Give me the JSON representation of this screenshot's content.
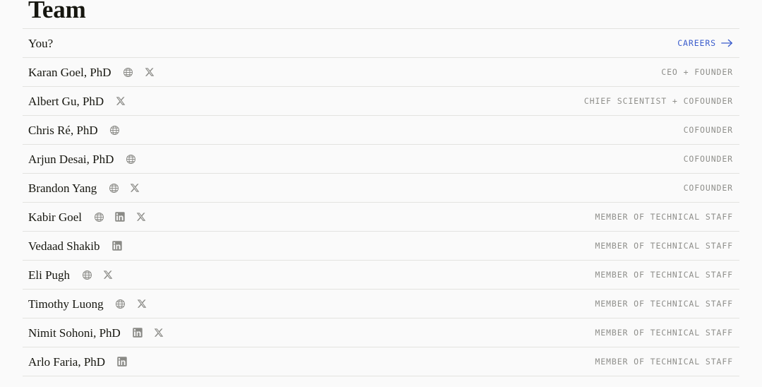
{
  "page": {
    "title": "Team",
    "background_color": "#fafafa",
    "divider_color": "#e3e3e0",
    "text_color": "#16160f",
    "muted_color": "#8f8f8b",
    "accent_color": "#3a5ccc"
  },
  "careers": {
    "label": "CAREERS",
    "arrow_icon": "arrow-right-icon"
  },
  "rows": [
    {
      "name": "You?",
      "socials": [],
      "role": "",
      "is_careers_row": true
    },
    {
      "name": "Karan Goel, PhD",
      "socials": [
        "globe-icon",
        "x-icon"
      ],
      "role": "CEO + FOUNDER",
      "is_careers_row": false
    },
    {
      "name": "Albert Gu, PhD",
      "socials": [
        "x-icon"
      ],
      "role": "CHIEF SCIENTIST + COFOUNDER",
      "is_careers_row": false
    },
    {
      "name": "Chris Ré, PhD",
      "socials": [
        "globe-icon"
      ],
      "role": "COFOUNDER",
      "is_careers_row": false
    },
    {
      "name": "Arjun Desai, PhD",
      "socials": [
        "globe-icon"
      ],
      "role": "COFOUNDER",
      "is_careers_row": false
    },
    {
      "name": "Brandon Yang",
      "socials": [
        "globe-icon",
        "x-icon"
      ],
      "role": "COFOUNDER",
      "is_careers_row": false
    },
    {
      "name": "Kabir Goel",
      "socials": [
        "globe-icon",
        "linkedin-icon",
        "x-icon"
      ],
      "role": "MEMBER OF TECHNICAL STAFF",
      "is_careers_row": false
    },
    {
      "name": "Vedaad Shakib",
      "socials": [
        "linkedin-icon"
      ],
      "role": "MEMBER OF TECHNICAL STAFF",
      "is_careers_row": false
    },
    {
      "name": "Eli Pugh",
      "socials": [
        "globe-icon",
        "x-icon"
      ],
      "role": "MEMBER OF TECHNICAL STAFF",
      "is_careers_row": false
    },
    {
      "name": "Timothy Luong",
      "socials": [
        "globe-icon",
        "x-icon"
      ],
      "role": "MEMBER OF TECHNICAL STAFF",
      "is_careers_row": false
    },
    {
      "name": "Nimit Sohoni, PhD",
      "socials": [
        "linkedin-icon",
        "x-icon"
      ],
      "role": "MEMBER OF TECHNICAL STAFF",
      "is_careers_row": false
    },
    {
      "name": "Arlo Faria, PhD",
      "socials": [
        "linkedin-icon"
      ],
      "role": "MEMBER OF TECHNICAL STAFF",
      "is_careers_row": false
    }
  ]
}
